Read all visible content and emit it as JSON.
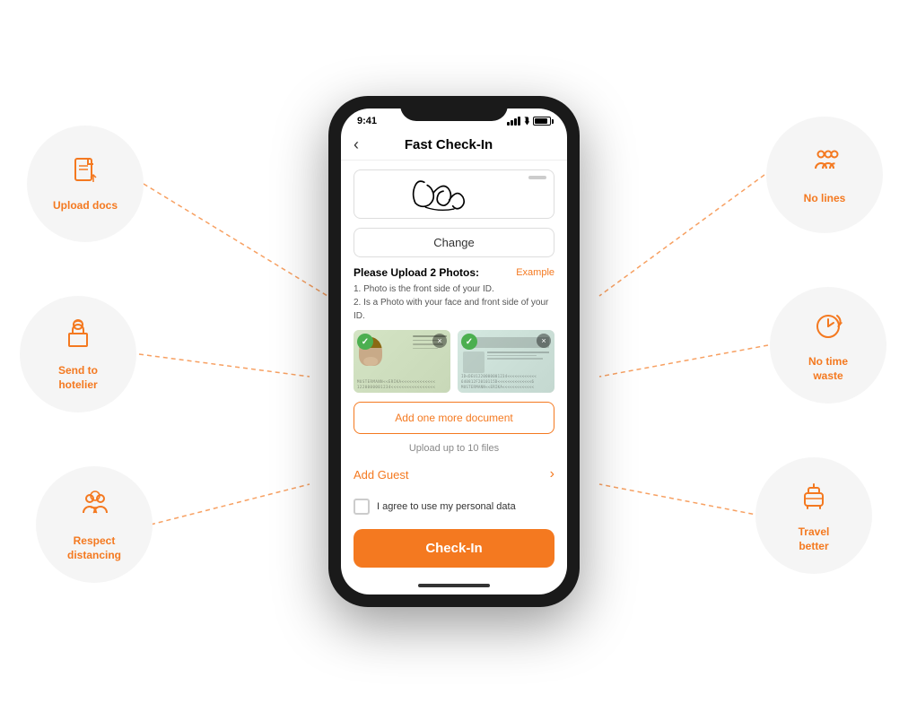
{
  "statusBar": {
    "time": "9:41",
    "signal": "signal",
    "wifi": "wifi",
    "battery": "battery"
  },
  "header": {
    "title": "Fast Check-In",
    "backLabel": "‹"
  },
  "signature": {
    "changeButton": "Change"
  },
  "uploadSection": {
    "title": "Please Upload 2 Photos:",
    "exampleLink": "Example",
    "instruction1": "1. Photo is the front side of your ID.",
    "instruction2": "2. Is a Photo with your face and front side of your ID.",
    "addDocButton": "Add one more document",
    "uploadLimit": "Upload up to 10 files"
  },
  "addGuest": {
    "label": "Add Guest"
  },
  "consent": {
    "checkboxLabel": "I agree to use my personal data"
  },
  "checkinButton": {
    "label": "Check-In"
  },
  "features": {
    "uploadDocs": {
      "label": "Upload docs"
    },
    "sendHotelier": {
      "label": "Send to\nhotelier"
    },
    "respectDistancing": {
      "label": "Respect\ndistancing"
    },
    "noLines": {
      "label": "No lines"
    },
    "noTimeWaste": {
      "label": "No time\nwaste"
    },
    "travelBetter": {
      "label": "Travel\nbetter"
    }
  },
  "idCard": {
    "mrzLine1": "MUSTERMANN<<ERIKA<<<<<<<<<<<<<",
    "mrzLine2": "1220000001234<<<<<<<<<<<<<<<<<",
    "mrzLine3": "640812F2010115D<<<<<<<<<<<<<<6",
    "mrzBack1": "ID<DEU1220000001234<<<<<<<<<<<<",
    "mrzBack2": "640812F2010115D<<<<<<<<<<<<<<6",
    "mrzBack3": "MUSTERMANN<<ERIKA<<<<<<<<<<<<<"
  }
}
